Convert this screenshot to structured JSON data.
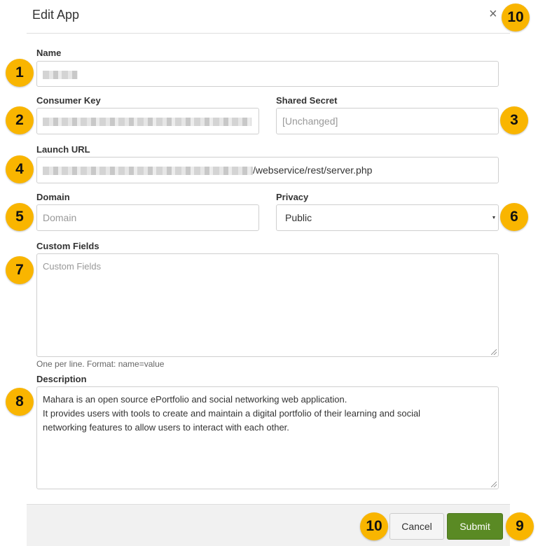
{
  "dialog": {
    "title": "Edit App",
    "close_symbol": "×"
  },
  "fields": {
    "name": {
      "label": "Name"
    },
    "consumer_key": {
      "label": "Consumer Key"
    },
    "shared_secret": {
      "label": "Shared Secret",
      "placeholder": "[Unchanged]"
    },
    "launch_url": {
      "label": "Launch URL",
      "value_suffix": "/webservice/rest/server.php"
    },
    "domain": {
      "label": "Domain",
      "placeholder": "Domain"
    },
    "privacy": {
      "label": "Privacy",
      "value": "Public"
    },
    "custom_fields": {
      "label": "Custom Fields",
      "placeholder": "Custom Fields",
      "help": "One per line. Format: name=value"
    },
    "description": {
      "label": "Description",
      "line1": "Mahara is an open source ePortfolio and social networking web application.",
      "line2": "It provides users with tools to create and maintain a digital portfolio of their learning and social",
      "line3": "networking features to allow users to interact with each other."
    }
  },
  "buttons": {
    "cancel": "Cancel",
    "submit": "Submit"
  },
  "callouts": [
    "1",
    "2",
    "3",
    "4",
    "5",
    "6",
    "7",
    "8",
    "9",
    "10",
    "10"
  ],
  "colors": {
    "callout": "#f9b500",
    "submit": "#5a8a24"
  }
}
